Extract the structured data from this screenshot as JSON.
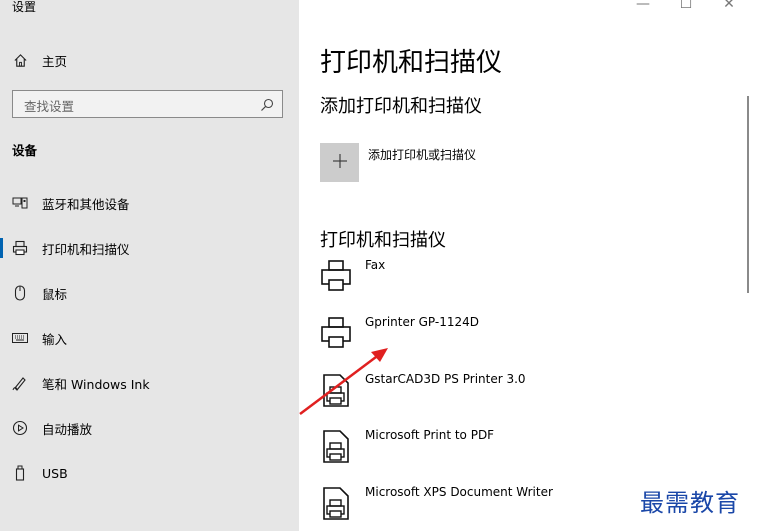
{
  "window": {
    "title": "设置",
    "minimize": "—",
    "maximize": "☐",
    "close": "✕"
  },
  "sidebar": {
    "home_label": "主页",
    "search_placeholder": "查找设置",
    "section_title": "设备",
    "items": [
      {
        "label": "蓝牙和其他设备",
        "icon": "bluetooth-devices-icon"
      },
      {
        "label": "打印机和扫描仪",
        "icon": "printer-icon"
      },
      {
        "label": "鼠标",
        "icon": "mouse-icon"
      },
      {
        "label": "输入",
        "icon": "keyboard-icon"
      },
      {
        "label": "笔和 Windows Ink",
        "icon": "pen-icon"
      },
      {
        "label": "自动播放",
        "icon": "autoplay-icon"
      },
      {
        "label": "USB",
        "icon": "usb-icon"
      }
    ],
    "selected_index": 1
  },
  "main": {
    "title": "打印机和扫描仪",
    "add_section_title": "添加打印机和扫描仪",
    "add_button_label": "添加打印机或扫描仪",
    "list_section_title": "打印机和扫描仪",
    "printers": [
      {
        "name": "Fax",
        "icon": "fax-printer-icon"
      },
      {
        "name": "Gprinter GP-1124D",
        "icon": "printer-icon"
      },
      {
        "name": "GstarCAD3D PS Printer 3.0",
        "icon": "document-printer-icon"
      },
      {
        "name": "Microsoft Print to PDF",
        "icon": "document-printer-icon"
      },
      {
        "name": "Microsoft XPS Document Writer",
        "icon": "document-printer-icon"
      }
    ]
  },
  "watermark": "最需教育",
  "colors": {
    "sidebar_bg": "#e6e6e6",
    "accent": "#0063b1",
    "annotation_arrow": "#e02020",
    "watermark": "#1a47a8"
  }
}
